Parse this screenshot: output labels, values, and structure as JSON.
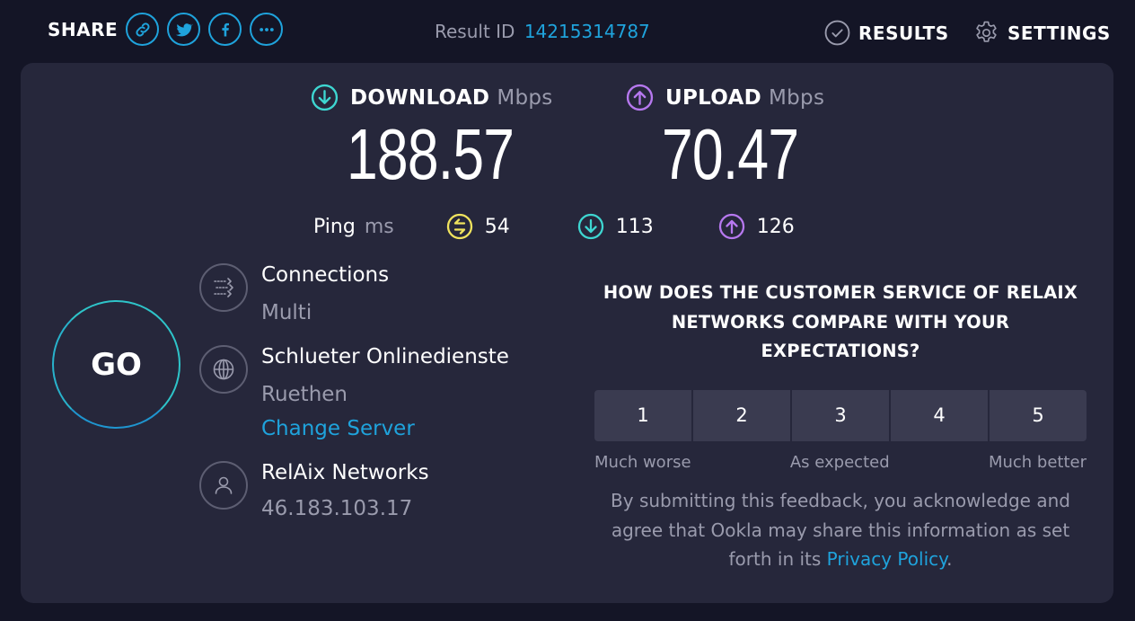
{
  "header": {
    "share_label": "SHARE",
    "share_buttons": [
      {
        "name": "link-icon"
      },
      {
        "name": "twitter-icon"
      },
      {
        "name": "facebook-icon"
      },
      {
        "name": "more-icon"
      }
    ],
    "result_id_label": "Result ID",
    "result_id_value": "14215314787",
    "results_label": "RESULTS",
    "settings_label": "SETTINGS"
  },
  "speeds": {
    "download": {
      "label": "DOWNLOAD",
      "unit": "Mbps",
      "value": "188.57",
      "color": "#3ed6d1"
    },
    "upload": {
      "label": "UPLOAD",
      "unit": "Mbps",
      "value": "70.47",
      "color": "#b678ef"
    }
  },
  "ping": {
    "label": "Ping",
    "unit": "ms",
    "idle": "54",
    "download": "113",
    "upload": "126",
    "idle_color": "#f0e35e"
  },
  "go_label": "GO",
  "connections": {
    "title": "Connections",
    "value": "Multi"
  },
  "server": {
    "title": "Schlueter Onlinedienste",
    "location": "Ruethen",
    "change_label": "Change Server"
  },
  "isp": {
    "title": "RelAix Networks",
    "ip": "46.183.103.17"
  },
  "survey": {
    "question": "HOW DOES THE CUSTOMER SERVICE OF RELAIX NETWORKS COMPARE WITH YOUR EXPECTATIONS?",
    "ratings": [
      "1",
      "2",
      "3",
      "4",
      "5"
    ],
    "scale_low": "Much worse",
    "scale_mid": "As expected",
    "scale_high": "Much better",
    "disclaimer_text": "By submitting this feedback, you acknowledge and agree that Ookla may share this information as set forth in its ",
    "privacy_link": "Privacy Policy",
    "disclaimer_end": "."
  },
  "colors": {
    "accent": "#1fa3dc",
    "background": "#141526",
    "panel": "#26273b"
  }
}
